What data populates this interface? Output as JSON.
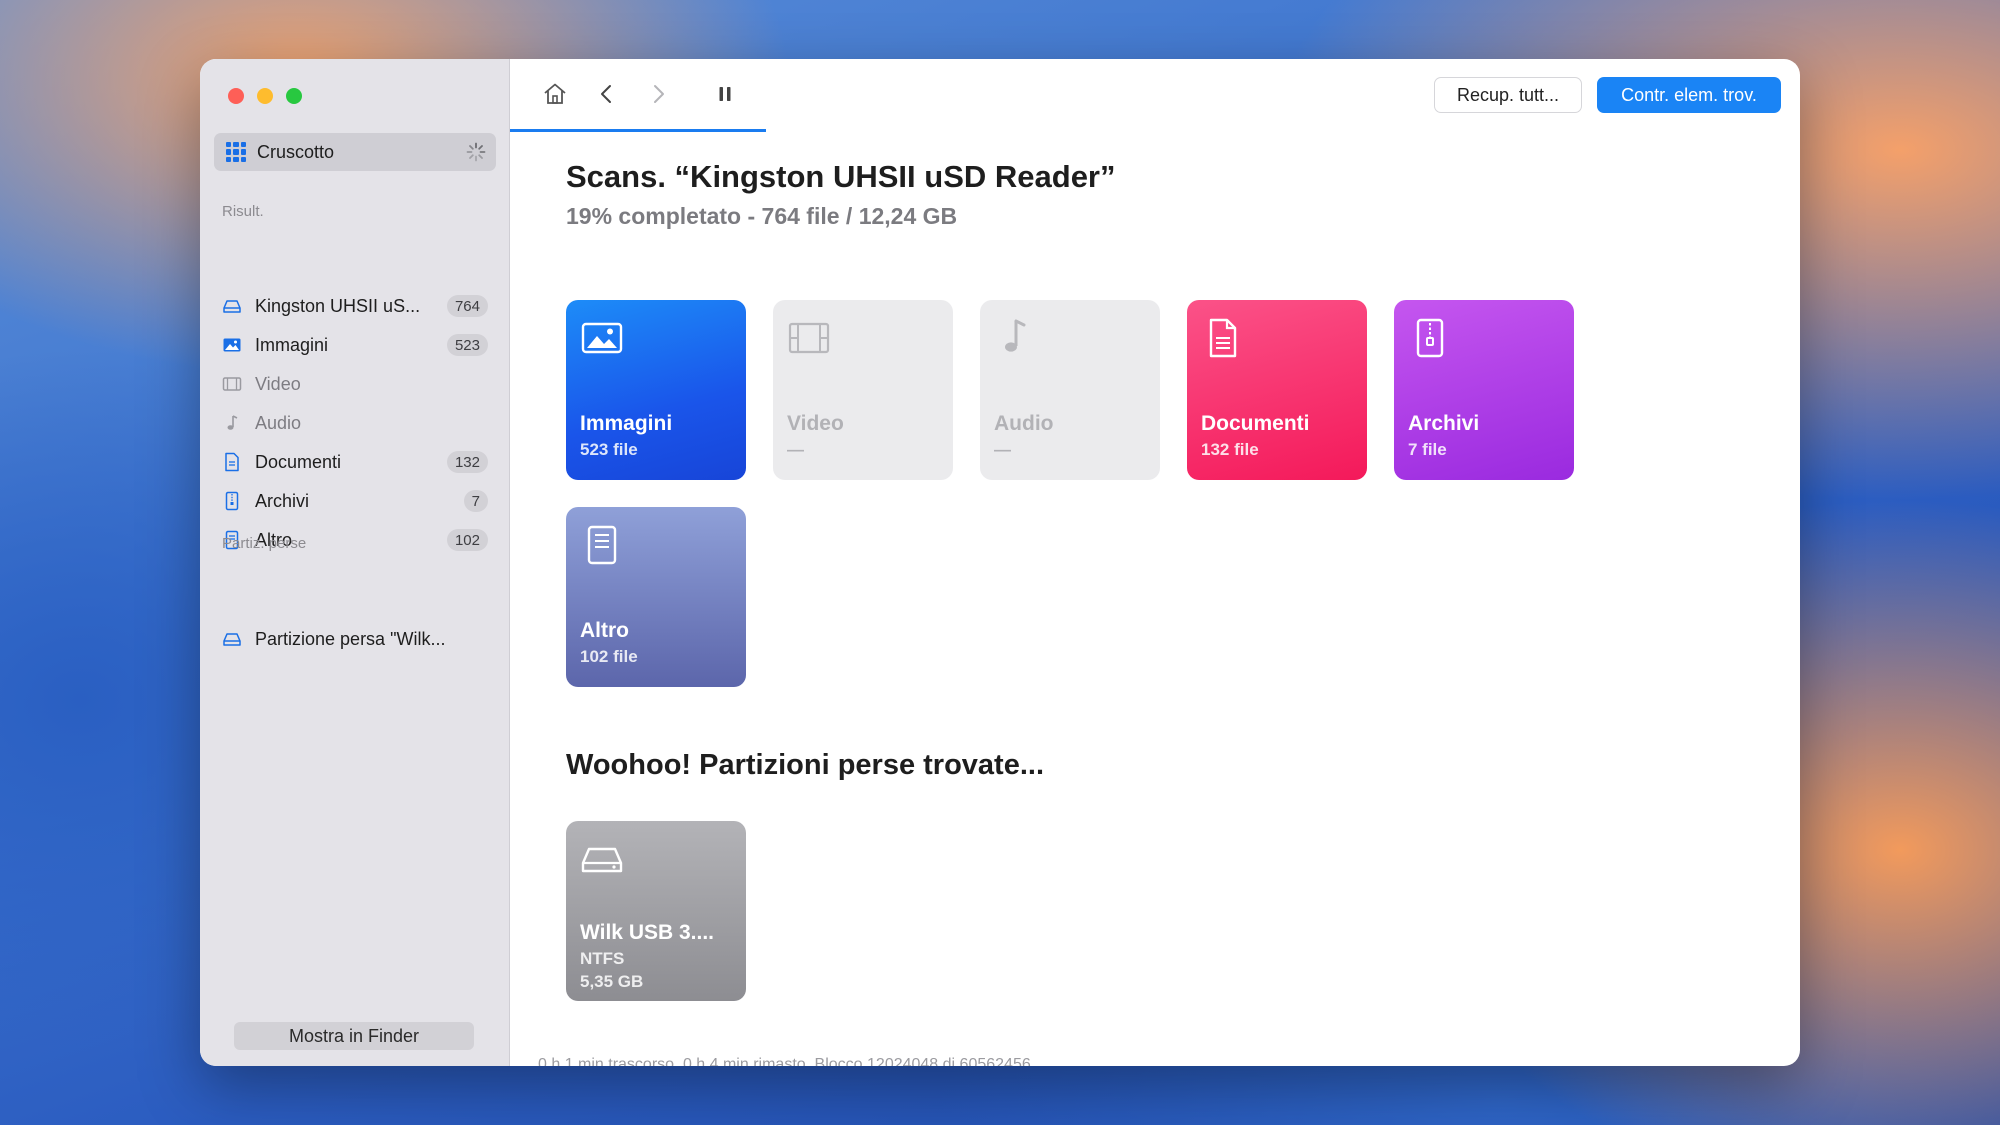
{
  "sidebar": {
    "dashboard_label": "Cruscotto",
    "results_header": "Risult.",
    "items": [
      {
        "label": "Kingston UHSII uS...",
        "count": "764",
        "icon": "drive-icon"
      },
      {
        "label": "Immagini",
        "count": "523",
        "icon": "image-icon"
      },
      {
        "label": "Video",
        "count": "",
        "icon": "film-icon"
      },
      {
        "label": "Audio",
        "count": "",
        "icon": "music-note-icon"
      },
      {
        "label": "Documenti",
        "count": "132",
        "icon": "document-icon"
      },
      {
        "label": "Archivi",
        "count": "7",
        "icon": "archive-icon"
      },
      {
        "label": "Altro",
        "count": "102",
        "icon": "other-file-icon"
      }
    ],
    "lost_header": "Partiz. perse",
    "lost_item": "Partizione persa \"Wilk...",
    "finder_button": "Mostra in Finder"
  },
  "toolbar": {
    "recover_all": "Recup. tutt...",
    "review_found": "Contr. elem. trov.",
    "scan_progress": 0.19
  },
  "main": {
    "title": "Scans. “Kingston UHSII uSD Reader”",
    "subtitle": "19% completato - 764 file / 12,24 GB",
    "tiles": [
      {
        "name": "Immagini",
        "count": "523 file"
      },
      {
        "name": "Video",
        "count": "—"
      },
      {
        "name": "Audio",
        "count": "—"
      },
      {
        "name": "Documenti",
        "count": "132 file"
      },
      {
        "name": "Archivi",
        "count": "7 file"
      },
      {
        "name": "Altro",
        "count": "102 file"
      }
    ],
    "found_title": "Woohoo! Partizioni perse trovate...",
    "partition": {
      "name": "Wilk USB 3....",
      "fs": "NTFS",
      "size": "5,35 GB"
    },
    "status": "0 h 1 min trascorso, 0 h 4 min rimasto. Blocco 12024048 di 60562456"
  },
  "colors": {
    "accent": "#1a84f5",
    "images": "#1a55ea",
    "documents": "#f4195a",
    "archives": "#9a2adf",
    "other": "#5c66ab"
  }
}
